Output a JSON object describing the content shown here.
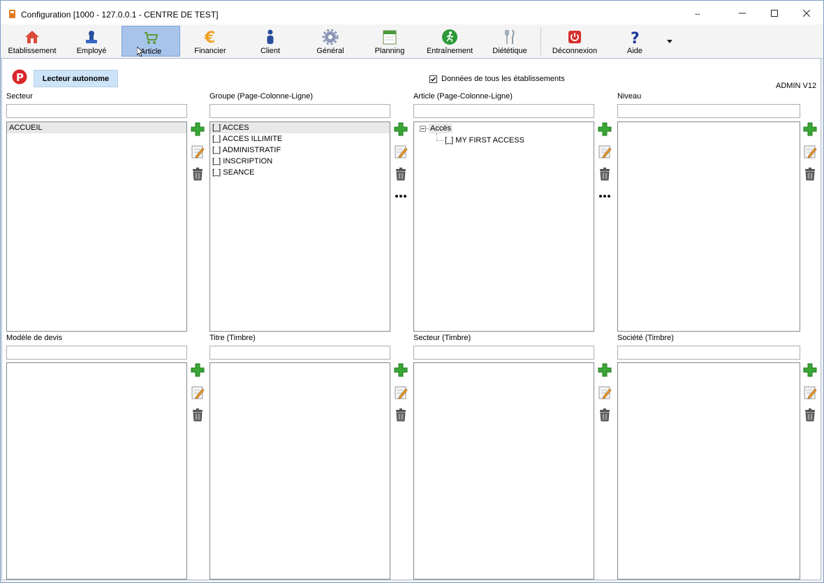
{
  "window": {
    "title": "Configuration [1000 - 127.0.0.1 - CENTRE DE TEST]",
    "controls": {
      "resize": "↔",
      "minimize": "—",
      "maximize": "☐",
      "close": "✕"
    }
  },
  "toolbar": {
    "items": [
      {
        "label": "Etablissement",
        "icon": "house-icon"
      },
      {
        "label": "Employé",
        "icon": "employee-stamp-icon"
      },
      {
        "label": "Article",
        "icon": "shopping-cart-icon",
        "active": true
      },
      {
        "label": "Financier",
        "icon": "euro-icon"
      },
      {
        "label": "Client",
        "icon": "person-icon"
      },
      {
        "label": "Général",
        "icon": "gear-icon"
      },
      {
        "label": "Planning",
        "icon": "calendar-icon"
      },
      {
        "label": "Entraînement",
        "icon": "runner-icon"
      },
      {
        "label": "Diététique",
        "icon": "cutlery-icon"
      },
      {
        "label": "Déconnexion",
        "icon": "power-icon"
      },
      {
        "label": "Aide",
        "icon": "question-icon"
      }
    ]
  },
  "header": {
    "kiosk_button": "Lecteur autonome",
    "all_sites_label": "Données de tous les établissements",
    "all_sites_checked": true,
    "version": "ADMIN V12"
  },
  "panels": {
    "secteur": {
      "label": "Secteur",
      "filter": "",
      "items": [
        "ACCUEIL"
      ]
    },
    "groupe": {
      "label": "Groupe (Page-Colonne-Ligne)",
      "filter": "",
      "items": [
        "[_] ACCES",
        "[_] ACCES ILLIMITE",
        "[_] ADMINISTRATIF",
        "[_] INSCRIPTION",
        "[_] SEANCE"
      ]
    },
    "article": {
      "label": "Article (Page-Colonne-Ligne)",
      "filter": "",
      "tree": {
        "root": "Accès",
        "children": [
          "[_] MY FIRST ACCESS"
        ]
      }
    },
    "niveau": {
      "label": "Niveau",
      "filter": "",
      "items": []
    },
    "modele_devis": {
      "label": "Modèle de devis",
      "filter": "",
      "items": []
    },
    "titre_timbre": {
      "label": "Titre (Timbre)",
      "filter": "",
      "items": []
    },
    "secteur_timbre": {
      "label": "Secteur (Timbre)",
      "filter": "",
      "items": []
    },
    "societe_timbre": {
      "label": "Société (Timbre)",
      "filter": "",
      "items": []
    }
  },
  "colors": {
    "accent": "#a8c4ea",
    "add_green": "#3aa635",
    "logo_red": "#d9262b"
  }
}
